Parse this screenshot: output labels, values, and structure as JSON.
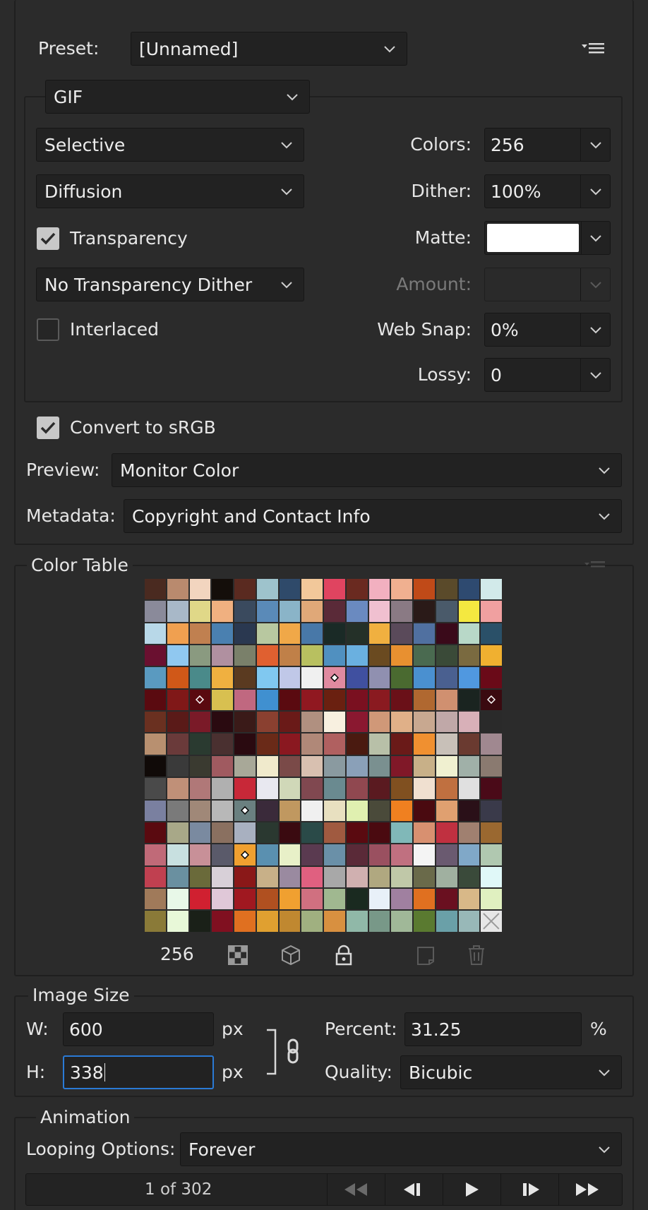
{
  "preset": {
    "label": "Preset:",
    "value": "[Unnamed]",
    "menu_icon": "panel-menu-icon"
  },
  "format": {
    "value": "GIF"
  },
  "reduction": {
    "value": "Selective"
  },
  "dither_algo": {
    "value": "Diffusion"
  },
  "transparency": {
    "label": "Transparency",
    "checked": true
  },
  "transparency_dither": {
    "value": "No Transparency Dither"
  },
  "interlaced": {
    "label": "Interlaced",
    "checked": false
  },
  "colors": {
    "label": "Colors:",
    "value": "256"
  },
  "dither": {
    "label": "Dither:",
    "value": "100%"
  },
  "matte": {
    "label": "Matte:",
    "color": "#ffffff"
  },
  "amount": {
    "label": "Amount:",
    "value": ""
  },
  "web_snap": {
    "label": "Web Snap:",
    "value": "0%"
  },
  "lossy": {
    "label": "Lossy:",
    "value": "0"
  },
  "convert_srgb": {
    "label": "Convert to sRGB",
    "checked": true
  },
  "preview": {
    "label": "Preview:",
    "value": "Monitor Color"
  },
  "metadata": {
    "label": "Metadata:",
    "value": "Copyright and Contact Info"
  },
  "color_table": {
    "title": "Color Table",
    "count": "256",
    "swatches": [
      "#4a2a20",
      "#b98a6e",
      "#f2d5bf",
      "#140e0a",
      "#5a2a20",
      "#9ec3cc",
      "#2f4a6a",
      "#f2c89a",
      "#e04460",
      "#6a2a20",
      "#f2b0c0",
      "#f0b090",
      "#c04a18",
      "#5a4a2a",
      "#2e4a70",
      "#d2eaea",
      "#8a8a9a",
      "#a8b8c8",
      "#e0d888",
      "#f0b080",
      "#3a4a5e",
      "#5a8ab8",
      "#8ab4c8",
      "#e0a878",
      "#5a2a38",
      "#6a8ac0",
      "#f0c0d0",
      "#8a7a84",
      "#2a1a18",
      "#4a5a6a",
      "#f4e840",
      "#f0a0a0",
      "#b8d8e8",
      "#f0a050",
      "#c08050",
      "#4a80b0",
      "#2a3850",
      "#b8c8a0",
      "#f0a848",
      "#4878a8",
      "#1a2a26",
      "#243028",
      "#f0b040",
      "#5a4a5a",
      "#5070a0",
      "#3a0a1a",
      "#b8d8c8",
      "#2a5068",
      "#6a1030",
      "#90c8f0",
      "#8a9a80",
      "#b090a0",
      "#7a806a",
      "#e06030",
      "#c08048",
      "#b8c060",
      "#5090c0",
      "#6ab0e0",
      "#6a4a20",
      "#e89030",
      "#4a6a50",
      "#3a4a38",
      "#7a6a40",
      "#f0b030",
      "#5a9ac0",
      "#d05818",
      "#4a8a8a",
      "#f0b040",
      "#5a3a20",
      "#80c8f0",
      "#c0c8e8",
      "#f0f0f0",
      "#e08aa0",
      "#4050a0",
      "#9090b0",
      "#4a6a30",
      "#4a90d0",
      "#4a6090",
      "#5098e0",
      "#6a0a18",
      "#5a0a10",
      "#801818",
      "#5a0a10",
      "#d8c050",
      "#c06880",
      "#4090d0",
      "#5a0a10",
      "#901820",
      "#6a2010",
      "#7a1020",
      "#8a1a20",
      "#6a1018",
      "#b06830",
      "#d09070",
      "#1a2420",
      "#3a0a10",
      "#6a3020",
      "#5a1a18",
      "#7a1a28",
      "#2a0a10",
      "#3a1a18",
      "#8a4030",
      "#6a1a18",
      "#b09080",
      "#f8f0e0",
      "#8a1830",
      "#d09878",
      "#e0b088",
      "#c8a890",
      "#c0a8a8",
      "#d8b0b8",
      "#2a2a2a",
      "#b89070",
      "#6a3a3a",
      "#2a3a30",
      "#4a3030",
      "#2a0a10",
      "#6a2a18",
      "#8a1820",
      "#b08878",
      "#b06060",
      "#4a1a10",
      "#b8c0a8",
      "#6a1a18",
      "#f09030",
      "#c8c0b8",
      "#6a3a30",
      "#a08890",
      "#100a08",
      "#3a3a3a",
      "#3a3a30",
      "#a05a60",
      "#a8a898",
      "#f0eacc",
      "#7a4a48",
      "#d8c0b0",
      "#8a9aa0",
      "#8aa0b8",
      "#7a9090",
      "#801828",
      "#c8b088",
      "#f0f0d0",
      "#a0b0a8",
      "#8a7a70",
      "#4a4a4a",
      "#c09078",
      "#b07878",
      "#b0b0b0",
      "#c82838",
      "#e8e8f0",
      "#d0d8b8",
      "#804850",
      "#6a8a90",
      "#904850",
      "#5a1a20",
      "#805020",
      "#f0e0d0",
      "#c07040",
      "#e0e0e0",
      "#4a0a18",
      "#7a80a0",
      "#7a7a7a",
      "#a08878",
      "#b8b8b8",
      "#6a8080",
      "#3a2a3a",
      "#c09860",
      "#f0f0f0",
      "#e8e0c0",
      "#e0f0b0",
      "#4a4a3a",
      "#f08020",
      "#4a0a10",
      "#e0a070",
      "#2a1018",
      "#3a3a4a",
      "#5a0a10",
      "#a8a888",
      "#7a8aa0",
      "#8a7060",
      "#a8b0c0",
      "#2a3830",
      "#3a0a10",
      "#2a4a48",
      "#a05a40",
      "#5a0a10",
      "#4a0a10",
      "#80b8b8",
      "#d89070",
      "#c03040",
      "#a08070",
      "#9a6830",
      "#c06a78",
      "#c8e0e0",
      "#c89098",
      "#5a5a6a",
      "#f0a030",
      "#5a90b0",
      "#e8f0c8",
      "#5a3a50",
      "#6a90a8",
      "#5a2a38",
      "#9a5060",
      "#c07080",
      "#f4f4f4",
      "#6a5a70",
      "#80a8c8",
      "#b0c8b0",
      "#c04050",
      "#6a90a0",
      "#6a6a3a",
      "#d8d0d8",
      "#8a1818",
      "#c8b088",
      "#9a8aa0",
      "#e06080",
      "#a8a8a8",
      "#d0b0b0",
      "#b0a880",
      "#c0c8a8",
      "#6a6a4a",
      "#a0b0a0",
      "#3a4a3a",
      "#e0f8f8",
      "#a07a5a",
      "#e8f8e8",
      "#d02030",
      "#e0c8d8",
      "#a01820",
      "#b05020",
      "#f0a030",
      "#d07080",
      "#a0b890",
      "#1a2a20",
      "#e8f0f8",
      "#a080a0",
      "#e07020",
      "#6a1020",
      "#d8b888",
      "#e0f0c0",
      "#8a7a38",
      "#e8f8d8",
      "#1a2018",
      "#801020",
      "#e07020",
      "#e0a030",
      "#c08830",
      "#a0b080",
      "#d89040",
      "#90b8a8",
      "#789888",
      "#a0b898",
      "#5a7a30",
      "#6aa0a8",
      "#98b8b8",
      "#dcdcdc"
    ]
  },
  "image_size": {
    "title": "Image Size",
    "w_label": "W:",
    "w_value": "600",
    "w_unit": "px",
    "h_label": "H:",
    "h_value": "338",
    "h_unit": "px",
    "percent_label": "Percent:",
    "percent_value": "31.25",
    "percent_unit": "%",
    "quality_label": "Quality:",
    "quality_value": "Bicubic"
  },
  "animation": {
    "title": "Animation",
    "looping_label": "Looping Options:",
    "looping_value": "Forever",
    "frame_counter": "1 of 302"
  }
}
